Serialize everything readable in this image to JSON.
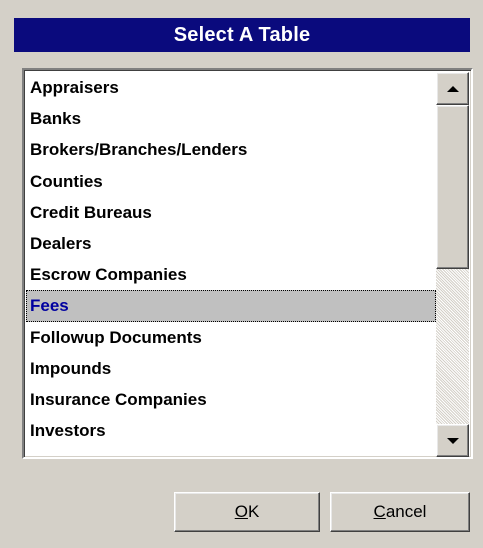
{
  "dialog": {
    "title": "Select A Table"
  },
  "list": {
    "items": [
      "Appraisers",
      "Banks",
      "Brokers/Branches/Lenders",
      "Counties",
      "Credit Bureaus",
      "Dealers",
      "Escrow Companies",
      "Fees",
      "Followup Documents",
      "Impounds",
      "Insurance Companies",
      "Investors"
    ],
    "selected_index": 7
  },
  "scrollbar": {
    "up_icon": "arrow-up-icon",
    "down_icon": "arrow-down-icon"
  },
  "buttons": {
    "ok": {
      "mnemonic": "O",
      "rest": "K"
    },
    "cancel": {
      "mnemonic": "C",
      "rest": "ancel"
    }
  },
  "colors": {
    "title_bar": "#0a0a7d",
    "selected_text": "#0000a0",
    "selected_bg": "#c0c0c0",
    "dialog_bg": "#d4d0c8"
  }
}
